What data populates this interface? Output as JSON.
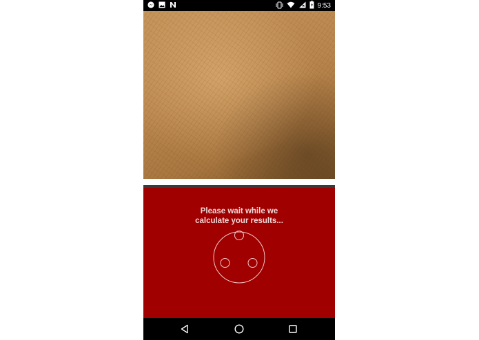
{
  "status_bar": {
    "time": "9:53",
    "left_icons": [
      "messenger-icon",
      "image-icon",
      "n-notification-icon"
    ],
    "right_icons": [
      "vibrate-icon",
      "wifi-icon",
      "signal-icon",
      "battery-icon"
    ]
  },
  "camera": {
    "subject": "skin-photo"
  },
  "result": {
    "message_line1": "Please wait while we",
    "message_line2": "calculate your results...",
    "background_color": "#a00000"
  },
  "nav_bar": {
    "icons": [
      "back-icon",
      "home-icon",
      "recent-apps-icon"
    ]
  }
}
